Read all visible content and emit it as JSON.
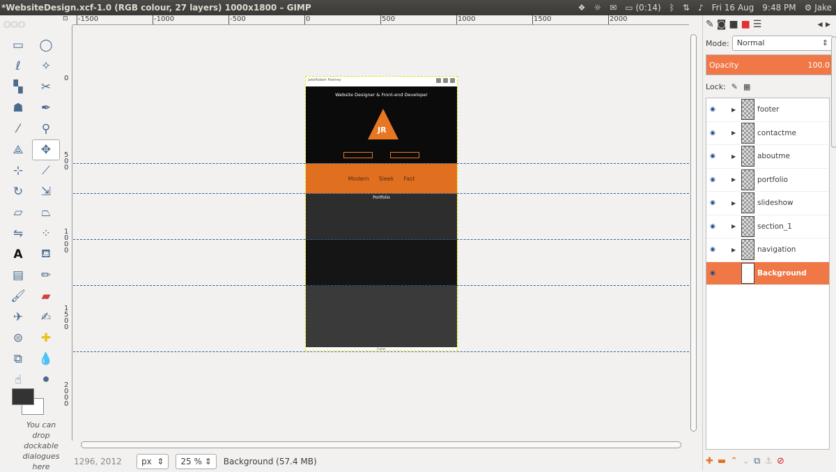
{
  "window": {
    "title": "*WebsiteDesign.xcf-1.0 (RGB colour, 27 layers) 1000x1800 – GIMP"
  },
  "indicators": {
    "battery": "(0:14)",
    "datetime": "Fri 16 Aug",
    "time": "9:48 PM",
    "user": "Jake"
  },
  "toolbox": {
    "drop_hint": "You can drop dockable dialogues here"
  },
  "ruler": {
    "h_ticks": [
      "-1500",
      "-1000",
      "-500",
      "0",
      "500",
      "1000",
      "1500",
      "2000"
    ],
    "v_ticks": [
      "0",
      "500",
      "1000",
      "1500",
      "2000"
    ]
  },
  "document": {
    "nav_name": "JakeRobert Powney",
    "tagline": "Website Designer & Front-end Developer",
    "logo_text": "JR",
    "slide_words": [
      "Modern",
      "Sleek",
      "Fast"
    ],
    "portfolio_label": "Portfolio",
    "footer_text": "Footer"
  },
  "statusbar": {
    "coords": "1296, 2012",
    "unit": "px",
    "zoom": "25 %",
    "layer_info": "Background (57.4 MB)"
  },
  "dock": {
    "mode_label": "Mode:",
    "mode_value": "Normal",
    "opacity_label": "Opacity",
    "opacity_value": "100.0",
    "lock_label": "Lock:",
    "layers": [
      {
        "name": "footer",
        "active": false
      },
      {
        "name": "contactme",
        "active": false
      },
      {
        "name": "aboutme",
        "active": false
      },
      {
        "name": "portfolio",
        "active": false
      },
      {
        "name": "slideshow",
        "active": false
      },
      {
        "name": "section_1",
        "active": false
      },
      {
        "name": "navigation",
        "active": false
      },
      {
        "name": "Background",
        "active": true
      }
    ]
  },
  "colors": {
    "accent": "#f07746",
    "slide": "#e07020",
    "guide": "#2a5fa8"
  }
}
